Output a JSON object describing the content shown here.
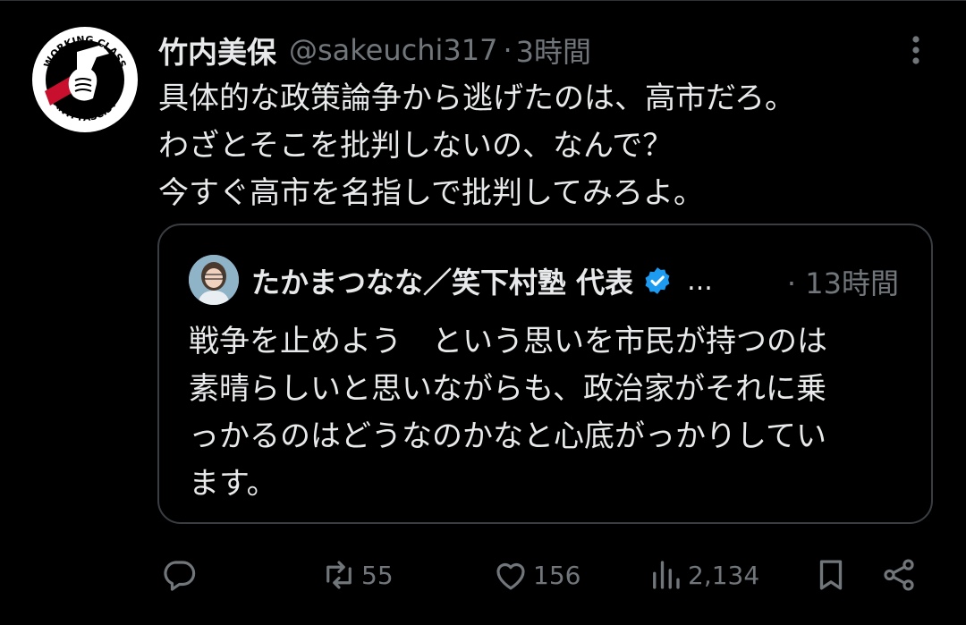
{
  "tweet": {
    "author": {
      "display_name": "竹内美保",
      "handle": "@sakeuchi317",
      "avatar_text_top": "WORKING CLASS",
      "avatar_text_bottom": "ANTI-FASCIST"
    },
    "separator": "·",
    "time": "3時間",
    "text_lines": [
      "具体的な政策論争から逃げたのは、高市だろ。",
      "わざとそこを批判しないの、なんで？",
      "今すぐ高市を名指しで批判してみろよ。"
    ]
  },
  "quote": {
    "author": {
      "display_name": "たかまつなな／笑下村塾 代表",
      "verified": true
    },
    "ellipsis": "...",
    "time": "· 13時間",
    "text_lines": [
      "戦争を止めよう　という思いを市民が持つのは",
      "素晴らしいと思いながらも、政治家がそれに乗",
      "っかるのはどうなのかなと心底がっかりしてい",
      "ます。"
    ]
  },
  "actions": {
    "reply": {
      "icon": "reply-icon"
    },
    "retweet": {
      "icon": "retweet-icon",
      "count": "55"
    },
    "like": {
      "icon": "heart-icon",
      "count": "156"
    },
    "views": {
      "icon": "views-icon",
      "count": "2,134"
    },
    "bookmark": {
      "icon": "bookmark-icon"
    },
    "share": {
      "icon": "share-icon"
    }
  },
  "colors": {
    "background": "#000000",
    "text_primary": "#e7e9ea",
    "text_secondary": "#71767b",
    "border": "#3a3e42",
    "verified": "#1d9bf0",
    "avatar_accent": "#c8102e"
  }
}
